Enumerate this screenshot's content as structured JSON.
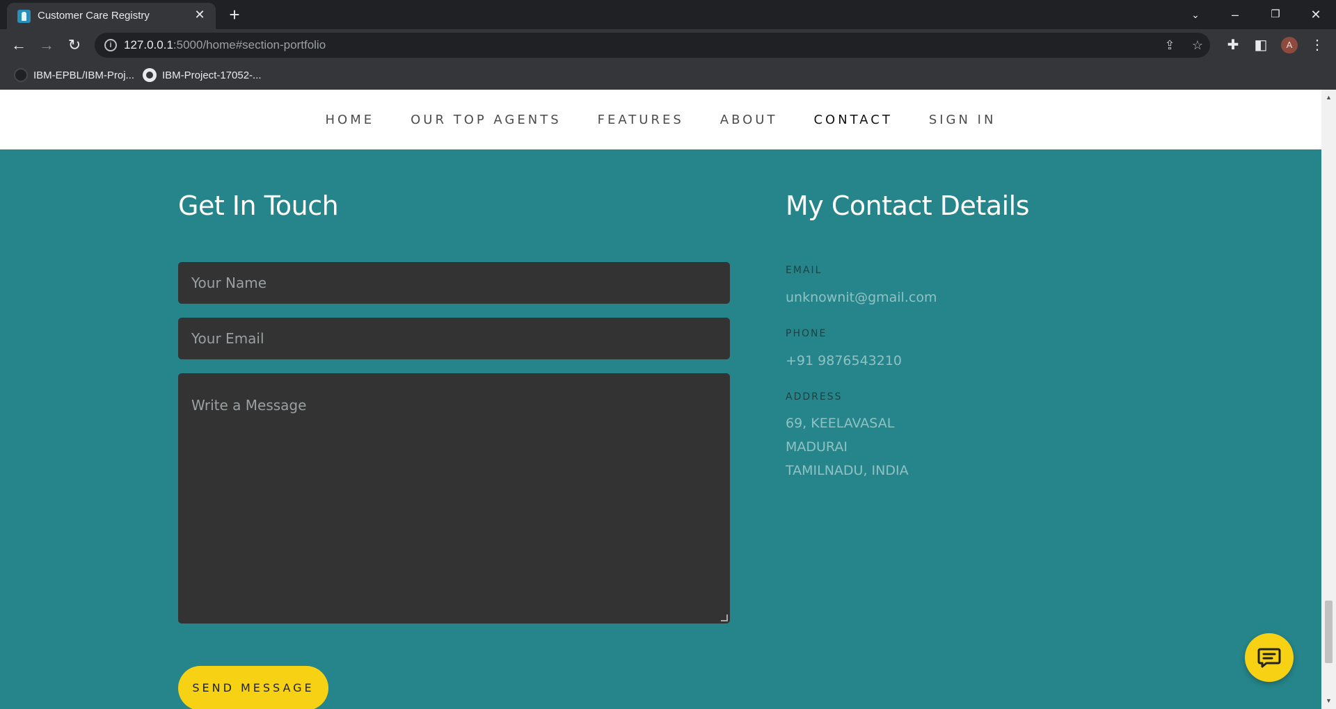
{
  "browser": {
    "tab_title": "Customer Care Registry",
    "url_host": "127.0.0.1",
    "url_rest": ":5000/home#section-portfolio",
    "bookmarks": [
      {
        "label": "IBM-EPBL/IBM-Proj...",
        "icon": "bookmark-favicon-icon"
      },
      {
        "label": "IBM-Project-17052-...",
        "icon": "github-icon"
      }
    ],
    "avatar_letter": "A"
  },
  "nav": {
    "items": [
      {
        "label": "HOME"
      },
      {
        "label": "OUR TOP AGENTS"
      },
      {
        "label": "FEATURES"
      },
      {
        "label": "ABOUT"
      },
      {
        "label": "CONTACT",
        "active": true
      },
      {
        "label": "SIGN IN"
      }
    ]
  },
  "contact_form": {
    "heading": "Get In Touch",
    "name_placeholder": "Your Name",
    "email_placeholder": "Your Email",
    "message_placeholder": "Write a Message",
    "send_label": "SEND MESSAGE"
  },
  "contact_details": {
    "heading": "My Contact Details",
    "email_label": "EMAIL",
    "email_value": "unknownit@gmail.com",
    "phone_label": "PHONE",
    "phone_value": "+91 9876543210",
    "address_label": "ADDRESS",
    "address_lines": [
      "69, KEELAVASAL",
      "MADURAI",
      "TAMILNADU, INDIA"
    ]
  },
  "colors": {
    "page_bg": "#26858a",
    "accent_yellow": "#f7d214",
    "field_bg": "#333333"
  }
}
